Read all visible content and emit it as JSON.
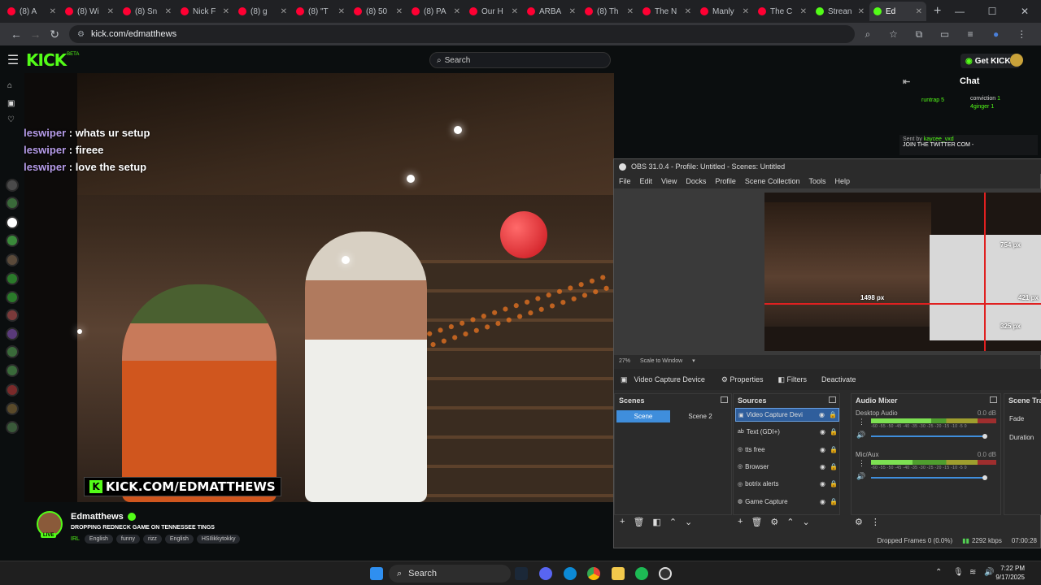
{
  "browser": {
    "tabs": [
      {
        "title": "(8) A",
        "color": "#ff0033"
      },
      {
        "title": "(8) Wi",
        "color": "#ff0033"
      },
      {
        "title": "(8) Sn",
        "color": "#ff0033"
      },
      {
        "title": "Nick F",
        "color": "#ff0033"
      },
      {
        "title": "(8) g",
        "color": "#ff0033"
      },
      {
        "title": "(8) \"T",
        "color": "#ff0033"
      },
      {
        "title": "(8) 50",
        "color": "#ff0033"
      },
      {
        "title": "(8) PA",
        "color": "#ff0033"
      },
      {
        "title": "Our H",
        "color": "#ff0033"
      },
      {
        "title": "ARBA",
        "color": "#ff0033"
      },
      {
        "title": "(8) Th",
        "color": "#ff0033"
      },
      {
        "title": "The N",
        "color": "#ff0033"
      },
      {
        "title": "Manly",
        "color": "#ff0033"
      },
      {
        "title": "The C",
        "color": "#ff0033"
      },
      {
        "title": "Strean",
        "color": "#53fc18"
      },
      {
        "title": "Ed",
        "color": "#53fc18",
        "active": true
      }
    ],
    "url": "kick.com/edmatthews"
  },
  "kick": {
    "logo": "KICK",
    "beta": "BETA",
    "search_placeholder": "Search",
    "get_kicks": "Get KICKs",
    "accent": "#53fc18"
  },
  "stream_overlay": {
    "chat": [
      {
        "user": "bladeswiper",
        "text": " : whats ur setup"
      },
      {
        "user": "bladeswiper",
        "text": " : fireee"
      },
      {
        "user": "bladeswiper",
        "text": " : love the setup"
      }
    ],
    "banner": "KICK.COM/EDMATTHEWS"
  },
  "streamer": {
    "name": "Edmatthews",
    "live": "LIVE",
    "title": "DROPPING REDNECK GAME ON TENNESSEE TINGS",
    "category": "IRL",
    "tags": [
      "English",
      "funny",
      "rizz",
      "English",
      "HSIlikkytokky"
    ]
  },
  "chat_panel": {
    "title": "Chat",
    "gifter": "runtrap",
    "gifter_count": "5",
    "contrib": [
      {
        "name": "conviction",
        "count": "1"
      },
      {
        "name": "4ginger",
        "count": "1"
      }
    ],
    "pinned_sent_by": "Sent by",
    "pinned_user": "kaycee_vxd",
    "pinned_text": "JOIN THE TWITTER COM -"
  },
  "obs": {
    "title": "OBS 31.0.4 - Profile: Untitled - Scenes: Untitled",
    "menu": [
      "File",
      "Edit",
      "View",
      "Docks",
      "Profile",
      "Scene Collection",
      "Tools",
      "Help"
    ],
    "preview_labels": {
      "a": "754 px",
      "b": "1498 px",
      "c": "421 px",
      "d": "325 px"
    },
    "zoom": "27%",
    "scale_mode": "Scale to Window",
    "selected_source": "Video Capture Device",
    "toolbar": {
      "properties": "Properties",
      "filters": "Filters",
      "deactivate": "Deactivate"
    },
    "scenes_title": "Scenes",
    "scenes": [
      "Scene",
      "Scene 2"
    ],
    "sources_title": "Sources",
    "sources": [
      {
        "name": "Video Capture Devi",
        "icon": "camera-icon"
      },
      {
        "name": "Text (GDI+)",
        "icon": "text-icon"
      },
      {
        "name": "tts free",
        "icon": "globe-icon"
      },
      {
        "name": "Browser",
        "icon": "globe-icon"
      },
      {
        "name": "botrix alerts",
        "icon": "globe-icon"
      },
      {
        "name": "Game Capture",
        "icon": "gamepad-icon"
      }
    ],
    "mixer_title": "Audio Mixer",
    "channels": [
      {
        "name": "Desktop Audio",
        "db": "0.0 dB",
        "level": 0.48,
        "volume": 1.0
      },
      {
        "name": "Mic/Aux",
        "db": "0.0 dB",
        "level": 0.33,
        "volume": 1.0
      }
    ],
    "meter_scale": "-60 -55 -50 -45 -40 -35 -30 -25 -20 -15 -10 -5 0",
    "transitions_title": "Scene Tra",
    "transition": "Fade",
    "duration_label": "Duration",
    "status": {
      "dropped": "Dropped Frames 0 (0.0%)",
      "bitrate": "2292 kbps",
      "time": "07:00:28"
    }
  },
  "taskbar": {
    "search": "Search",
    "time": "7:22 PM",
    "date": "9/17/2025"
  }
}
